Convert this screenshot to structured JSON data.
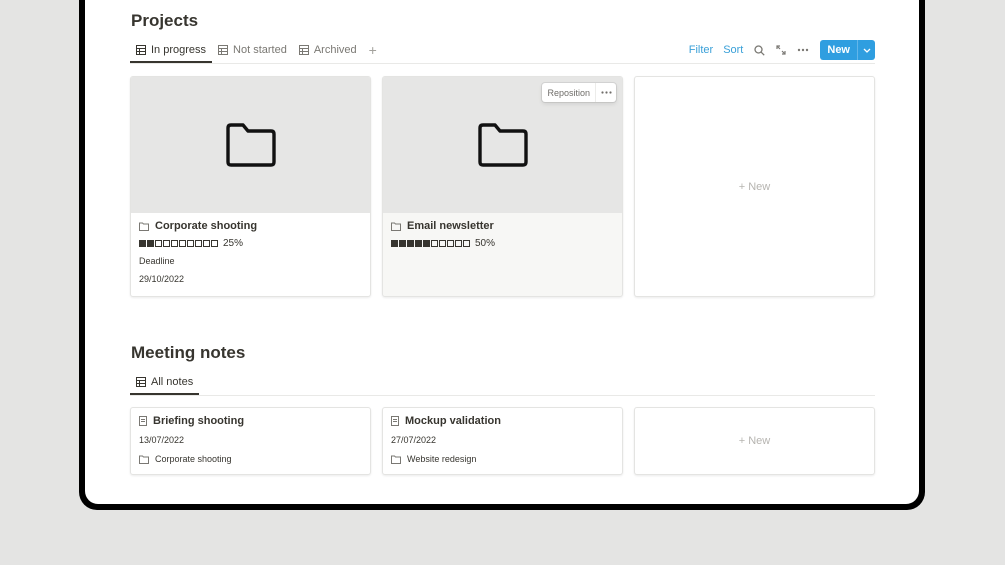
{
  "projects": {
    "title": "Projects",
    "tabs": [
      {
        "label": "In progress",
        "icon": "table-icon",
        "active": true
      },
      {
        "label": "Not started",
        "icon": "table-icon",
        "active": false
      },
      {
        "label": "Archived",
        "icon": "table-icon",
        "active": false
      }
    ],
    "add_tab": "+",
    "toolbar": {
      "filter": "Filter",
      "sort": "Sort",
      "new": "New"
    },
    "cards": [
      {
        "title": "Corporate shooting",
        "progress_pct": "25%",
        "progress_filled": 2,
        "progress_total": 10,
        "deadline_label": "Deadline",
        "deadline": "29/10/2022"
      },
      {
        "title": "Email newsletter",
        "progress_pct": "50%",
        "progress_filled": 5,
        "progress_total": 10
      }
    ],
    "reposition": "Reposition",
    "new_card": "+ New"
  },
  "meeting_notes": {
    "title": "Meeting notes",
    "tabs": [
      {
        "label": "All notes",
        "icon": "table-icon",
        "active": true
      }
    ],
    "cards": [
      {
        "title": "Briefing shooting",
        "date": "13/07/2022",
        "project": "Corporate shooting"
      },
      {
        "title": "Mockup validation",
        "date": "27/07/2022",
        "project": "Website redesign"
      }
    ],
    "new_card": "+ New"
  },
  "colors": {
    "accent": "#2f9ee0",
    "link": "#3aa0d8",
    "text": "#37352f",
    "background": "#e4e4e3"
  }
}
